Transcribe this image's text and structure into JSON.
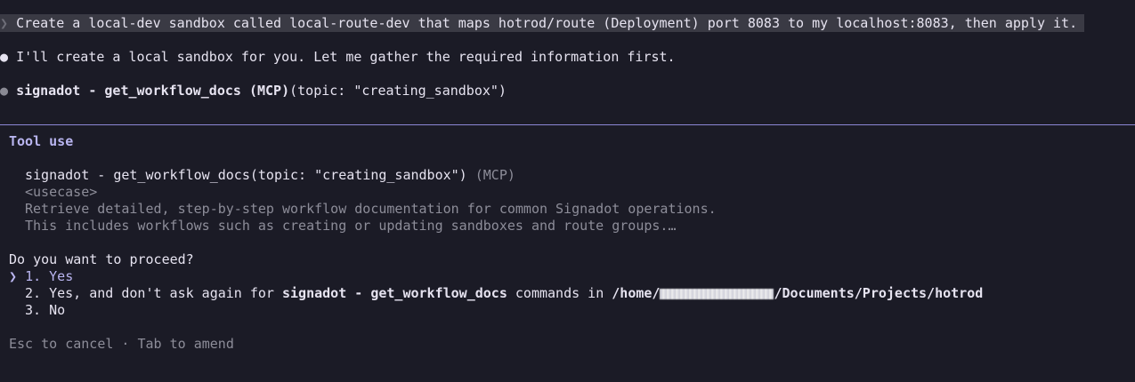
{
  "conversation": {
    "user_prompt": "Create a local-dev sandbox called local-route-dev that maps hotrod/route (Deployment) port 8083 to my localhost:8083, then apply it.",
    "assistant_message": "I'll create a local sandbox for you. Let me gather the required information first.",
    "tool_call_name": "signadot - get_workflow_docs (MCP)",
    "tool_call_args": "(topic: \"creating_sandbox\")"
  },
  "tool_use": {
    "header": "Tool use",
    "call": "signadot - get_workflow_docs(topic: \"creating_sandbox\")",
    "call_suffix": " (MCP)",
    "description_lines": [
      "<usecase>",
      "Retrieve detailed, step-by-step workflow documentation for common Signadot operations.",
      "This includes workflows such as creating or updating sandboxes and route groups.…"
    ]
  },
  "permission": {
    "question": "Do you want to proceed?",
    "cursor": "❯",
    "options": [
      {
        "number": "1.",
        "label": "Yes"
      },
      {
        "number": "2.",
        "label_prefix": "Yes, and don't ask again for ",
        "label_tool": "signadot - get_workflow_docs",
        "label_middle": " commands in ",
        "path_start": "/home/",
        "path_end": "/Documents/Projects/hotrod"
      },
      {
        "number": "3.",
        "label": "No"
      }
    ]
  },
  "footer": {
    "hint": "Esc to cancel · Tab to amend"
  },
  "colors": {
    "background": "#1b1b26",
    "accent": "#b9b5f0",
    "divider": "#8c87d6",
    "dim_text": "#8d8d99"
  }
}
